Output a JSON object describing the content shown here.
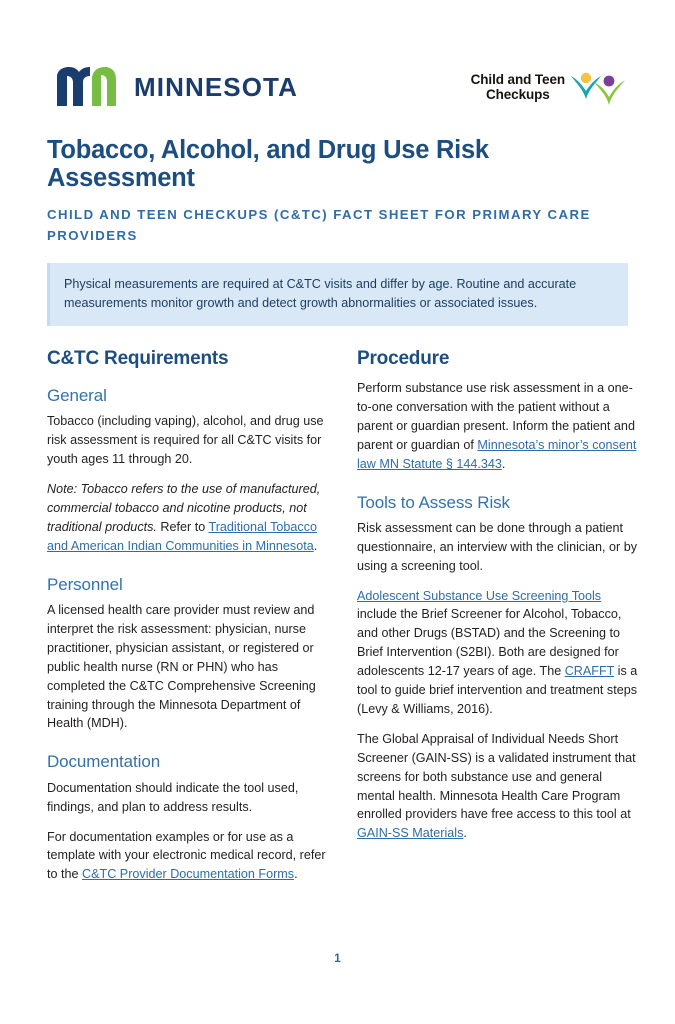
{
  "header": {
    "state_logo": {
      "mark_name": "mn-logo-mark",
      "wordmark": "MINNESOTA",
      "navy": "#1b3d6d",
      "green": "#78bd43"
    },
    "program_logo": {
      "line1": "Child and Teen",
      "line2": "Checkups",
      "teal": "#1aa3b0",
      "green": "#8cc63f",
      "yellow": "#f5c343",
      "purple": "#7b3f98"
    }
  },
  "title": {
    "heading": "Tobacco, Alcohol, and Drug Use Risk Assessment",
    "subtitle": "Child and Teen Checkups (C&TC) Fact Sheet for Primary Care Providers",
    "heading_color": "#1c4e82",
    "subtitle_color": "#2f6da8"
  },
  "callout": {
    "text": "Physical measurements are required at C&TC visits and differ by age. Routine and accurate measurements monitor growth and detect growth abnormalities or associated issues.",
    "background": "#d9e8f7"
  },
  "left_column": {
    "section_title": "C&TC Requirements",
    "general": {
      "heading": "General",
      "paragraph": "Tobacco (including vaping), alcohol, and drug use risk assessment is required for all C&TC visits for youth ages 11 through 20.",
      "note_prefix": "Note: Tobacco refers to the use of manufactured, commercial tobacco and nicotine products, not traditional products. ",
      "note_refer": "Refer to ",
      "note_link": "Traditional Tobacco and American Indian Communities in Minnesota",
      "note_suffix": "."
    },
    "personnel": {
      "heading": "Personnel",
      "paragraph": "A licensed health care provider must review and interpret the risk assessment: physician, nurse practitioner, physician assistant, or registered or public health nurse (RN or PHN) who has completed the C&TC Comprehensive Screening training through the Minnesota Department of Health (MDH)."
    },
    "documentation": {
      "heading": "Documentation",
      "paragraph1": "Documentation should indicate the tool used, findings, and plan to address results.",
      "paragraph2_prefix": "For documentation examples or for use as a template with your electronic medical record, refer to the ",
      "paragraph2_link": "C&TC Provider Documentation Forms",
      "paragraph2_suffix": "."
    }
  },
  "right_column": {
    "procedure": {
      "heading": "Procedure",
      "paragraph_prefix": "Perform substance use risk assessment in a one-to-one conversation with the patient without a parent or guardian present. Inform the patient and parent or guardian of ",
      "paragraph_link": "Minnesota’s minor’s consent law MN Statute § 144.343",
      "paragraph_suffix": "."
    },
    "tools": {
      "heading": "Tools to Assess Risk",
      "paragraph1": "Risk assessment can be done through a patient questionnaire, an interview with the clinician, or by using a screening tool.",
      "paragraph2_link1": "Adolescent Substance Use Screening Tools",
      "paragraph2_mid": " include the Brief Screener for Alcohol, Tobacco, and other Drugs (BSTAD) and the Screening to Brief Intervention (S2BI). Both are designed for adolescents 12-17 years of age. The ",
      "paragraph2_link2": "CRAFFT",
      "paragraph2_suffix": " is a tool to guide brief intervention and treatment steps (Levy & Williams, 2016).",
      "paragraph3_prefix": "The Global Appraisal of Individual Needs Short Screener (GAIN-SS) is a validated instrument that screens for both substance use and general mental health. Minnesota Health Care Program enrolled providers have free access to this tool at ",
      "paragraph3_link": "GAIN-SS Materials",
      "paragraph3_suffix": "."
    }
  },
  "footer": {
    "page_number": "1"
  }
}
